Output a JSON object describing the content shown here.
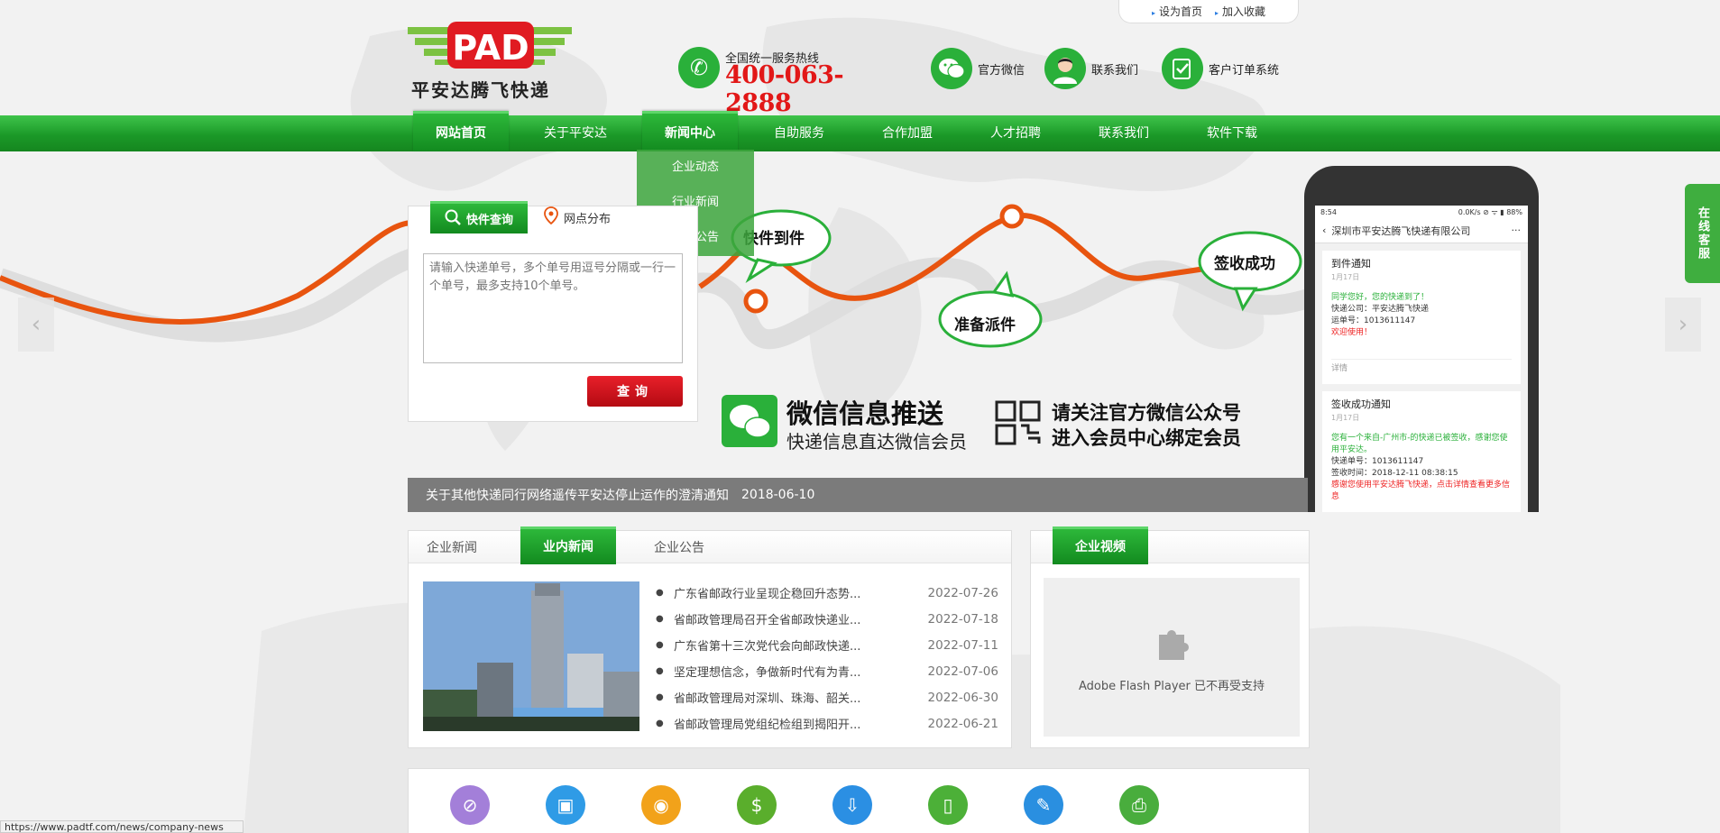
{
  "topbar": {
    "set_home": "设为首页",
    "add_fav": "加入收藏"
  },
  "logo": {
    "mark": "PAD",
    "text": "平安达腾飞快递"
  },
  "hotline": {
    "label": "全国统一服务热线",
    "number": "400-063-2888"
  },
  "header_links": [
    {
      "label": "官方微信",
      "icon": "wechat-icon"
    },
    {
      "label": "联系我们",
      "icon": "agent-icon"
    },
    {
      "label": "客户订单系统",
      "icon": "order-icon"
    }
  ],
  "nav": {
    "items": [
      "网站首页",
      "关于平安达",
      "新闻中心",
      "自助服务",
      "合作加盟",
      "人才招聘",
      "联系我们",
      "软件下载"
    ],
    "active": [
      "网站首页",
      "新闻中心"
    ],
    "dropdown": [
      "企业动态",
      "行业新闻",
      "企业公告"
    ]
  },
  "banner": {
    "bubble1": "快件到件",
    "bubble2": "准备派件",
    "bubble3": "签收成功",
    "wechat_title": "微信信息推送",
    "wechat_sub": "快递信息直达微信会员",
    "follow1": "请关注官方微信公众号",
    "follow2": "进入会员中心绑定会员",
    "phone": {
      "time": "8:54",
      "status": "0.0K/s ⊘ ᯤ ▮ 88%",
      "title": "深圳市平安达腾飞快递有限公司",
      "menu": "···",
      "card1": {
        "title": "到件通知",
        "date": "1月17日",
        "line1": "同学您好，您的快递到了！",
        "line2": "快递公司：平安达腾飞快递",
        "line3": "运单号：1013611147",
        "line4": "欢迎使用！",
        "detail": "详情"
      },
      "card2": {
        "title": "签收成功通知",
        "date": "1月17日",
        "line1": "您有一个来自-广州市-的快递已被签收，感谢您使用平安达。",
        "line2": "快递单号：1013611147",
        "line3": "签收时间：2018-12-11 08:38:15",
        "line4": "感谢您使用平安达腾飞快递，点击详情查看更多信息"
      }
    }
  },
  "query": {
    "tab_active": "快件查询",
    "tab_other": "网点分布",
    "placeholder": "请输入快递单号，多个单号用逗号分隔或一行一个单号，最多支持10个单号。",
    "button": "查询"
  },
  "ticker": {
    "text": "关于其他快递同行网络遥传平安达停止运作的澄清通知",
    "date": "2018-06-10"
  },
  "news": {
    "tabs": [
      "企业新闻",
      "业内新闻",
      "企业公告"
    ],
    "active_tab": "业内新闻",
    "items": [
      {
        "title": "广东省邮政行业呈现企稳回升态势...",
        "date": "2022-07-26"
      },
      {
        "title": "省邮政管理局召开全省邮政快递业...",
        "date": "2022-07-18"
      },
      {
        "title": "广东省第十三次党代会向邮政快递...",
        "date": "2022-07-11"
      },
      {
        "title": "坚定理想信念，争做新时代有为青...",
        "date": "2022-07-06"
      },
      {
        "title": "省邮政管理局对深圳、珠海、韶关...",
        "date": "2022-06-30"
      },
      {
        "title": "省邮政管理局党组纪检组到揭阳开...",
        "date": "2022-06-21"
      }
    ]
  },
  "video": {
    "tab": "企业视频",
    "message": "Adobe Flash Player 已不再受支持"
  },
  "services": [
    {
      "icon": "forbidden-icon",
      "color": "#a37fd9"
    },
    {
      "icon": "box-icon",
      "color": "#2f9be6"
    },
    {
      "icon": "location-icon",
      "color": "#f2a21a"
    },
    {
      "icon": "money-bag-icon",
      "color": "#5aae2c"
    },
    {
      "icon": "download-icon",
      "color": "#2b8fe3"
    },
    {
      "icon": "mobile-icon",
      "color": "#4cb038"
    },
    {
      "icon": "user-edit-icon",
      "color": "#2a8fe0"
    },
    {
      "icon": "printer-icon",
      "color": "#49ad3d"
    }
  ],
  "kefu": "在线客服",
  "status_url": "https://www.padtf.com/news/company-news"
}
